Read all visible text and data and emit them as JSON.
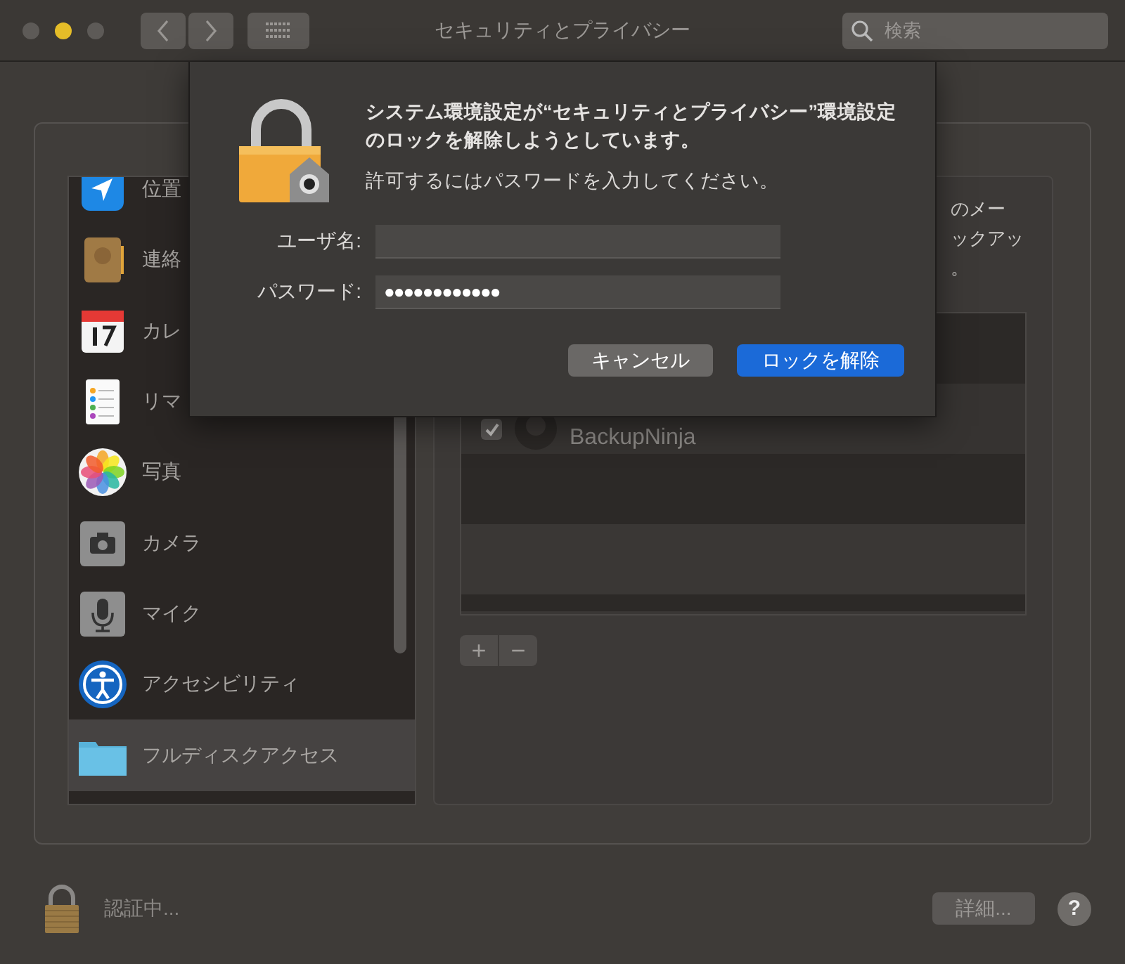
{
  "window": {
    "title": "セキュリティとプライバシー"
  },
  "search": {
    "placeholder": "検索"
  },
  "sidebar": {
    "items": [
      {
        "label": "位置",
        "selected": false
      },
      {
        "label": "連絡",
        "selected": false
      },
      {
        "label": "カレ",
        "selected": false
      },
      {
        "label": "リマ",
        "selected": false
      },
      {
        "label": "写真",
        "selected": false
      },
      {
        "label": "カメラ",
        "selected": false
      },
      {
        "label": "マイク",
        "selected": false
      },
      {
        "label": "アクセシビリティ",
        "selected": false
      },
      {
        "label": "フルディスクアクセス",
        "selected": true
      }
    ]
  },
  "detail": {
    "description_lines": [
      "のメー",
      "ックアッ",
      "。"
    ],
    "apps": [
      {
        "name": "BackupNinja",
        "checked": true
      }
    ],
    "add_button": "+",
    "remove_button": "−"
  },
  "footer": {
    "status": "認証中...",
    "advanced_button": "詳細...",
    "help_button": "?"
  },
  "dialog": {
    "heading": "システム環境設定が“セキュリティとプライバシー”環境設定のロックを解除しようとしています。",
    "message": "許可するにはパスワードを入力してください。",
    "fields": [
      {
        "label": "ユーザ名:"
      },
      {
        "label": "パスワード:",
        "value": "●●●●●●●●●●●●"
      }
    ],
    "buttons": [
      {
        "label": "キャンセル",
        "kind": "secondary"
      },
      {
        "label": "ロックを解除",
        "kind": "primary"
      }
    ]
  }
}
